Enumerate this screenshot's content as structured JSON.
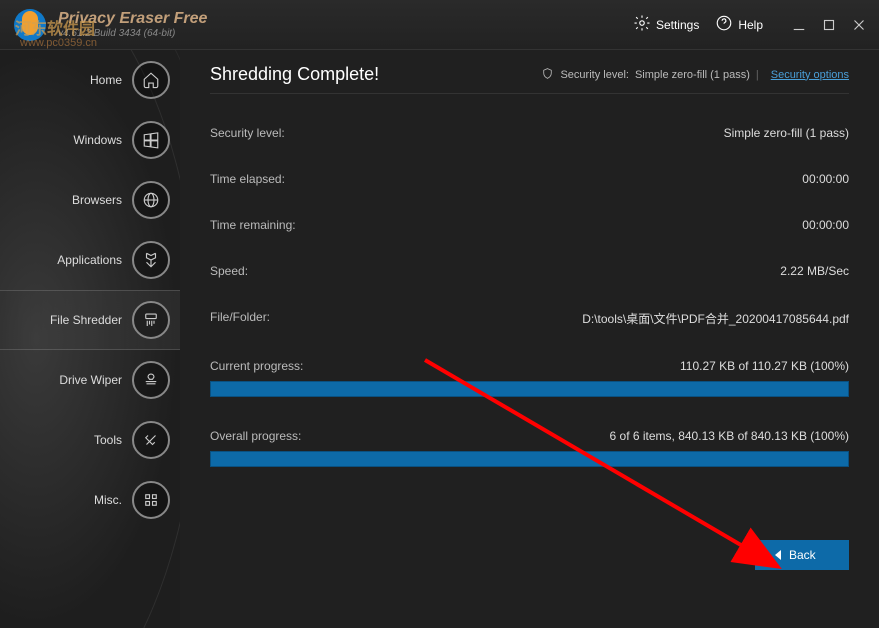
{
  "app": {
    "title": "Privacy Eraser Free",
    "version": "v4.61.2 Build 3434 (64-bit)"
  },
  "watermark": {
    "text": "河东软件园",
    "url": "www.pc0359.cn"
  },
  "header": {
    "settings": "Settings",
    "help": "Help"
  },
  "nav": {
    "home": "Home",
    "windows": "Windows",
    "browsers": "Browsers",
    "applications": "Applications",
    "file_shredder": "File Shredder",
    "drive_wiper": "Drive Wiper",
    "tools": "Tools",
    "misc": "Misc."
  },
  "main": {
    "title": "Shredding Complete!",
    "security_level_label": "Security level:",
    "security_level_value": "Simple zero-fill (1 pass)",
    "security_options": "Security options",
    "rows": {
      "security_label": "Security level:",
      "security_value": "Simple zero-fill (1 pass)",
      "time_elapsed_label": "Time elapsed:",
      "time_elapsed_value": "00:00:00",
      "time_remaining_label": "Time remaining:",
      "time_remaining_value": "00:00:00",
      "speed_label": "Speed:",
      "speed_value": "2.22 MB/Sec",
      "file_label": "File/Folder:",
      "file_value": "D:\\tools\\桌面\\文件\\PDF合并_20200417085644.pdf",
      "current_label": "Current progress:",
      "current_value": "110.27 KB of 110.27 KB (100%)",
      "overall_label": "Overall progress:",
      "overall_value": "6 of 6 items, 840.13 KB of 840.13 KB (100%)"
    },
    "back": "Back"
  }
}
